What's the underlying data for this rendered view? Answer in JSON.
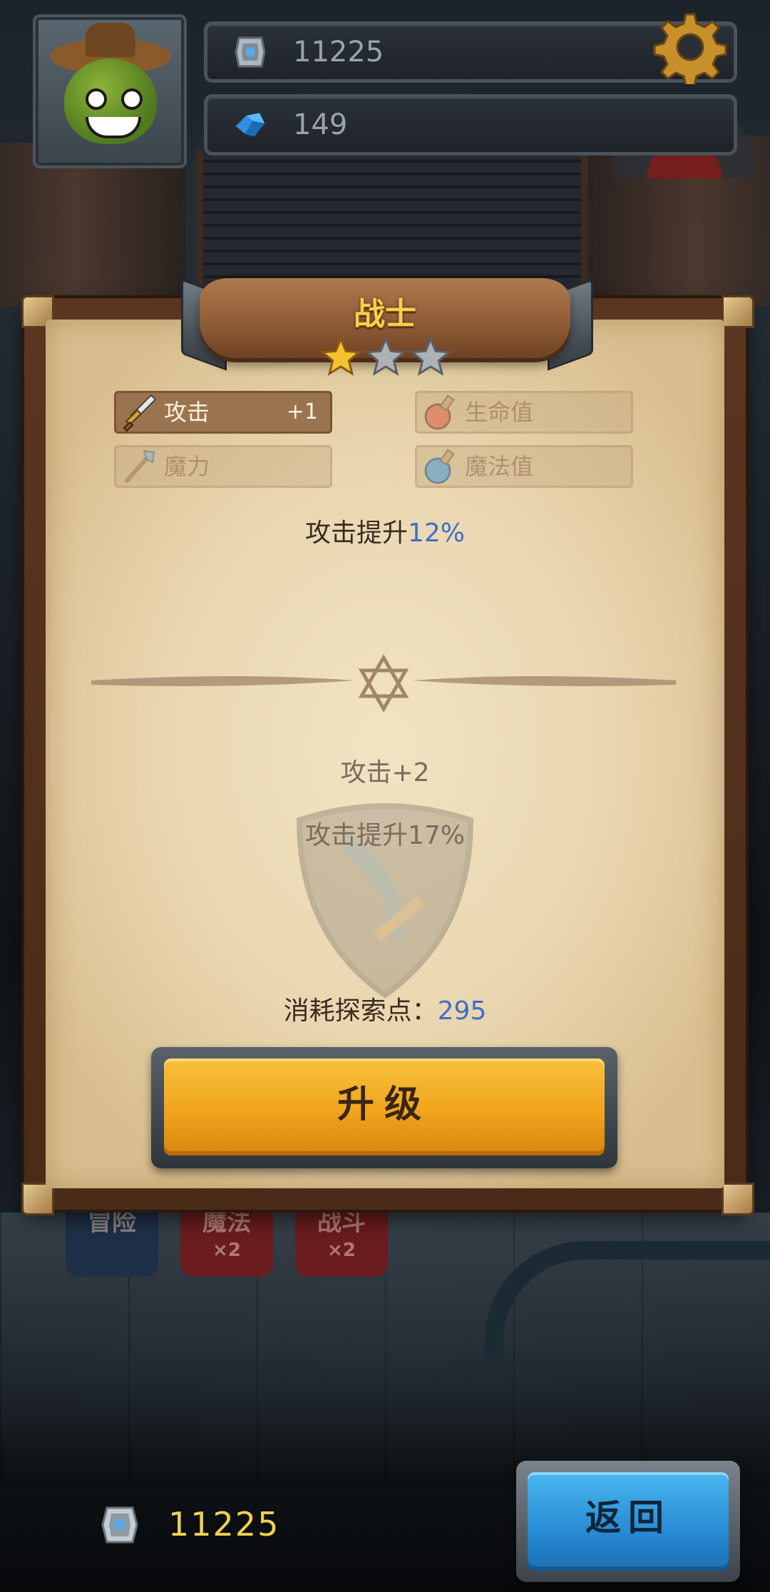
{
  "hud": {
    "currency_top": "11225",
    "gems": "149",
    "settings_icon": "gear-icon",
    "currency_icon": "silver-token-icon",
    "gem_icon": "blue-crystal-icon"
  },
  "background": {
    "banners": [
      {
        "label": "冒险",
        "sub": ""
      },
      {
        "label": "魔法",
        "sub": "×2"
      },
      {
        "label": "战斗",
        "sub": "×2"
      }
    ]
  },
  "panel": {
    "title": "战士",
    "stars_filled": 1,
    "stars_total": 3,
    "stats": [
      {
        "label": "攻击",
        "value": "+1",
        "active": true,
        "icon": "sword-icon"
      },
      {
        "label": "生命值",
        "value": "",
        "active": false,
        "icon": "red-potion-icon"
      },
      {
        "label": "魔力",
        "value": "",
        "active": false,
        "icon": "staff-icon"
      },
      {
        "label": "魔法值",
        "value": "",
        "active": false,
        "icon": "blue-potion-icon"
      }
    ],
    "current_bonus": {
      "prefix": "攻击提升",
      "value": "12%"
    },
    "next_level": {
      "attack": "攻击+2",
      "bonus": "攻击提升17%"
    },
    "cost": {
      "label": "消耗探索点：",
      "value": "295"
    },
    "upgrade_label": "升级"
  },
  "bottom": {
    "coins": "11225",
    "back_label": "返回"
  },
  "colors": {
    "accent_blue": "#3f6dc9",
    "title_gold": "#f5d04a",
    "upgrade_orange": "#f0a41c",
    "back_blue": "#2a8fd6"
  }
}
